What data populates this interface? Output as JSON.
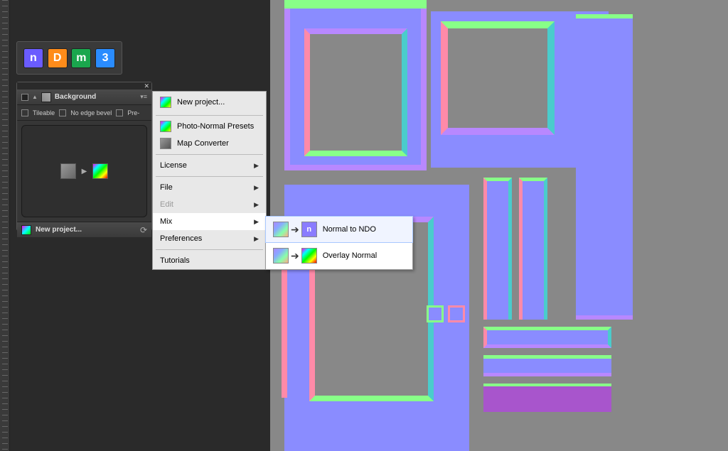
{
  "toolbar": {
    "buttons": [
      {
        "letter": "n"
      },
      {
        "letter": "D"
      },
      {
        "letter": "m"
      },
      {
        "letter": "3"
      }
    ]
  },
  "layer_panel": {
    "layer_name": "Background",
    "options": {
      "tileable": "Tileable",
      "no_edge_bevel": "No edge bevel",
      "pre": "Pre-"
    },
    "new_project": "New project..."
  },
  "context_menu": {
    "new_project": "New project...",
    "photo_normal": "Photo-Normal Presets",
    "map_converter": "Map Converter",
    "license": "License",
    "file": "File",
    "edit": "Edit",
    "mix": "Mix",
    "preferences": "Preferences",
    "tutorials": "Tutorials"
  },
  "submenu": {
    "normal_to_ndo": "Normal to NDO",
    "overlay_normal": "Overlay Normal",
    "ndo_letter": "n"
  }
}
